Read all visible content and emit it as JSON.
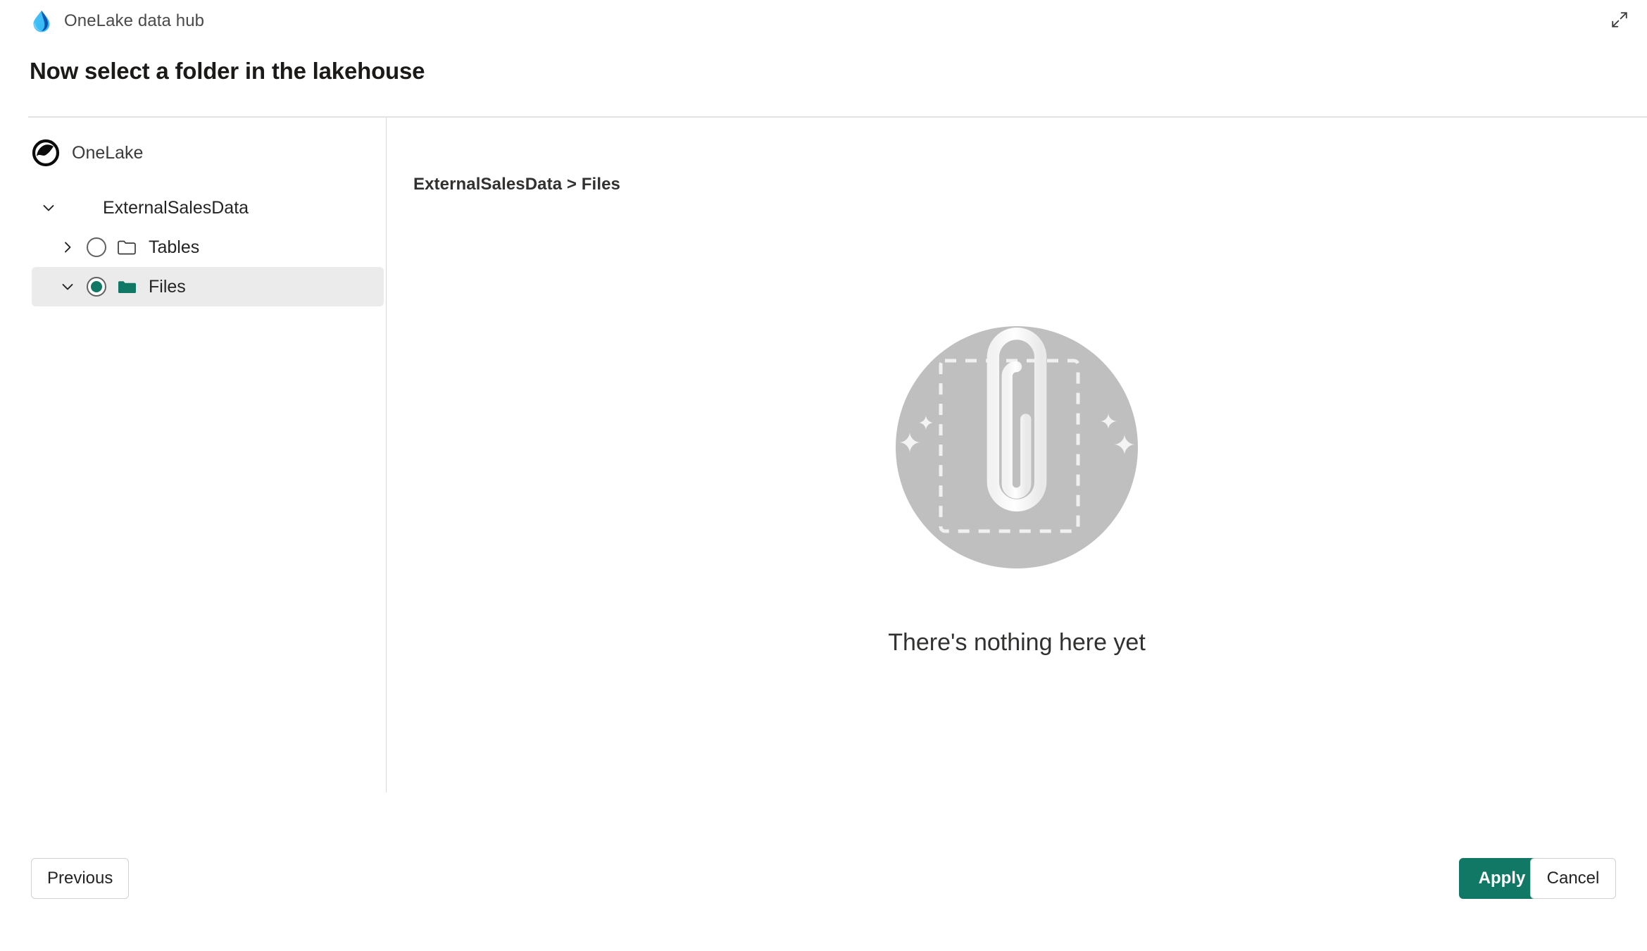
{
  "header": {
    "brand_title": "OneLake data hub",
    "brand_logo_icon": "onelake-droplet-logo",
    "expand_icon": "expand-diagonal-icon",
    "page_title": "Now select a folder in the lakehouse"
  },
  "sidebar": {
    "root_label": "OneLake",
    "root_logo_icon": "onelake-circle-logo",
    "tree": [
      {
        "label": "ExternalSalesData",
        "level": 1,
        "expanded": true,
        "twisty_icon": "chevron-down-icon",
        "has_radio": false,
        "has_folder": false,
        "selected": false
      },
      {
        "label": "Tables",
        "level": 2,
        "expanded": false,
        "twisty_icon": "chevron-right-icon",
        "has_radio": true,
        "radio_checked": false,
        "has_folder": true,
        "folder_icon": "folder-outline-icon",
        "selected": false
      },
      {
        "label": "Files",
        "level": 2,
        "expanded": true,
        "twisty_icon": "chevron-down-icon",
        "has_radio": true,
        "radio_checked": true,
        "has_folder": true,
        "folder_icon": "folder-filled-icon",
        "selected": true
      }
    ]
  },
  "main": {
    "breadcrumb": "ExternalSalesData > Files",
    "empty_state": {
      "illustration_icon": "paperclip-empty-illustration",
      "message": "There's nothing here yet"
    }
  },
  "footer": {
    "previous_label": "Previous",
    "apply_label": "Apply",
    "cancel_label": "Cancel"
  },
  "colors": {
    "accent": "#117865",
    "selected_row_bg": "#ebebeb",
    "divider": "#e3e3e3",
    "text_primary": "#242424",
    "illustration_circle": "#bfbfbf"
  }
}
